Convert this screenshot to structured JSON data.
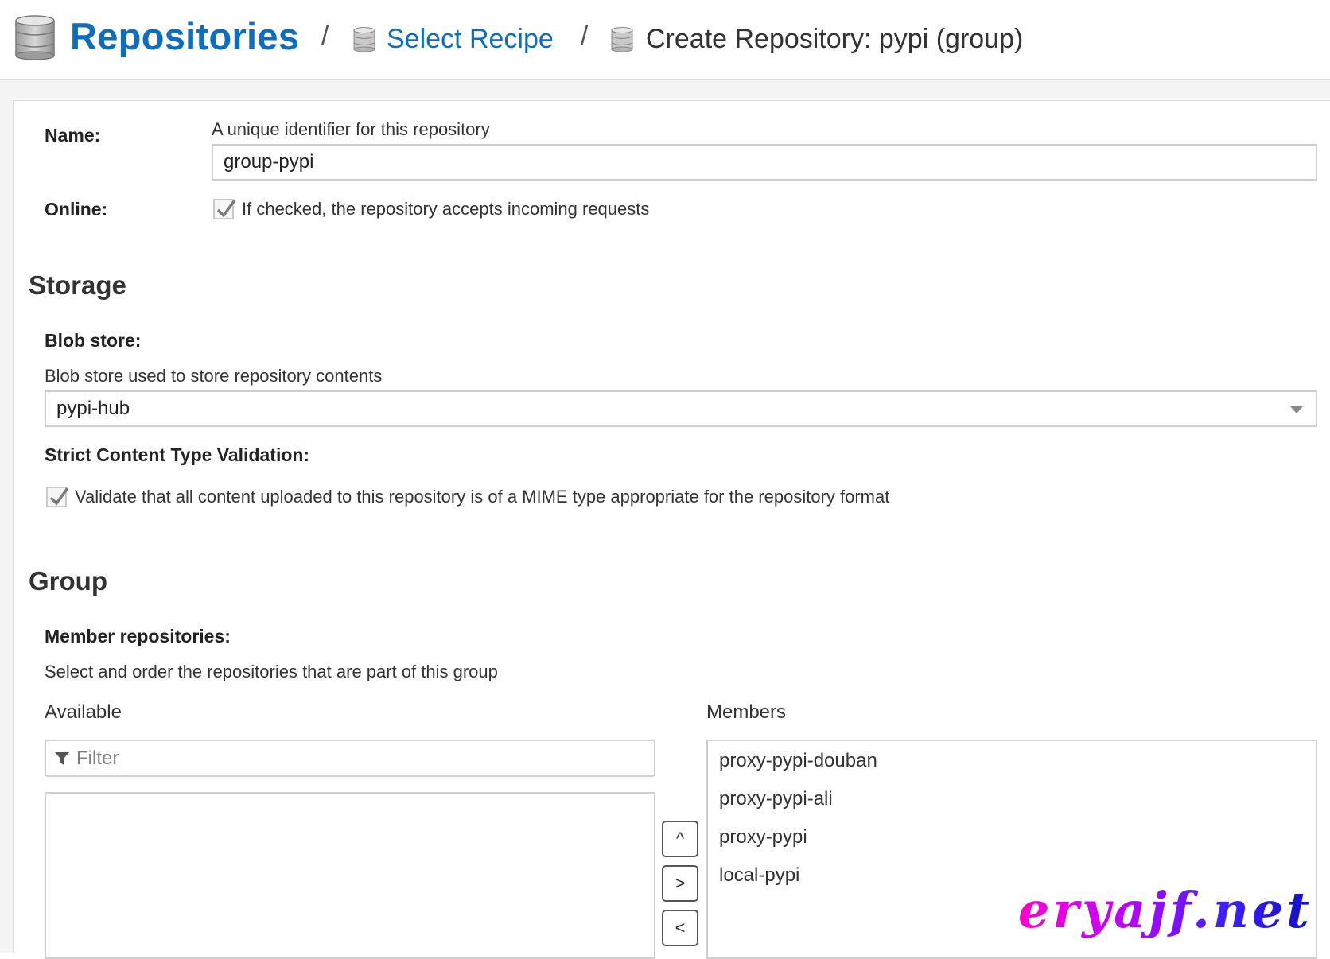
{
  "header": {
    "title": "Repositories",
    "separator": "/",
    "breadcrumb_link": "Select Recipe",
    "breadcrumb_current": "Create Repository: pypi (group)"
  },
  "form": {
    "name": {
      "label": "Name:",
      "help": "A unique identifier for this repository",
      "value": "group-pypi"
    },
    "online": {
      "label": "Online:",
      "checked": true,
      "help": "If checked, the repository accepts incoming requests"
    }
  },
  "storage": {
    "title": "Storage",
    "blob_store": {
      "label": "Blob store:",
      "help": "Blob store used to store repository contents",
      "value": "pypi-hub"
    },
    "strict_validation": {
      "label": "Strict Content Type Validation:",
      "checked": true,
      "help": "Validate that all content uploaded to this repository is of a MIME type appropriate for the repository format"
    }
  },
  "group": {
    "title": "Group",
    "members_label": "Member repositories:",
    "members_help": "Select and order the repositories that are part of this group",
    "available_label": "Available",
    "filter_placeholder": "Filter",
    "members_column_label": "Members",
    "members": [
      "proxy-pypi-douban",
      "proxy-pypi-ali",
      "proxy-pypi",
      "local-pypi"
    ],
    "buttons": {
      "up": "^",
      "add": ">",
      "remove": "<"
    }
  },
  "watermark": "eryajf.net",
  "colors": {
    "accent": "#0f6dbe",
    "border": "#cfcfcf",
    "page_bg": "#f4f4f4"
  }
}
